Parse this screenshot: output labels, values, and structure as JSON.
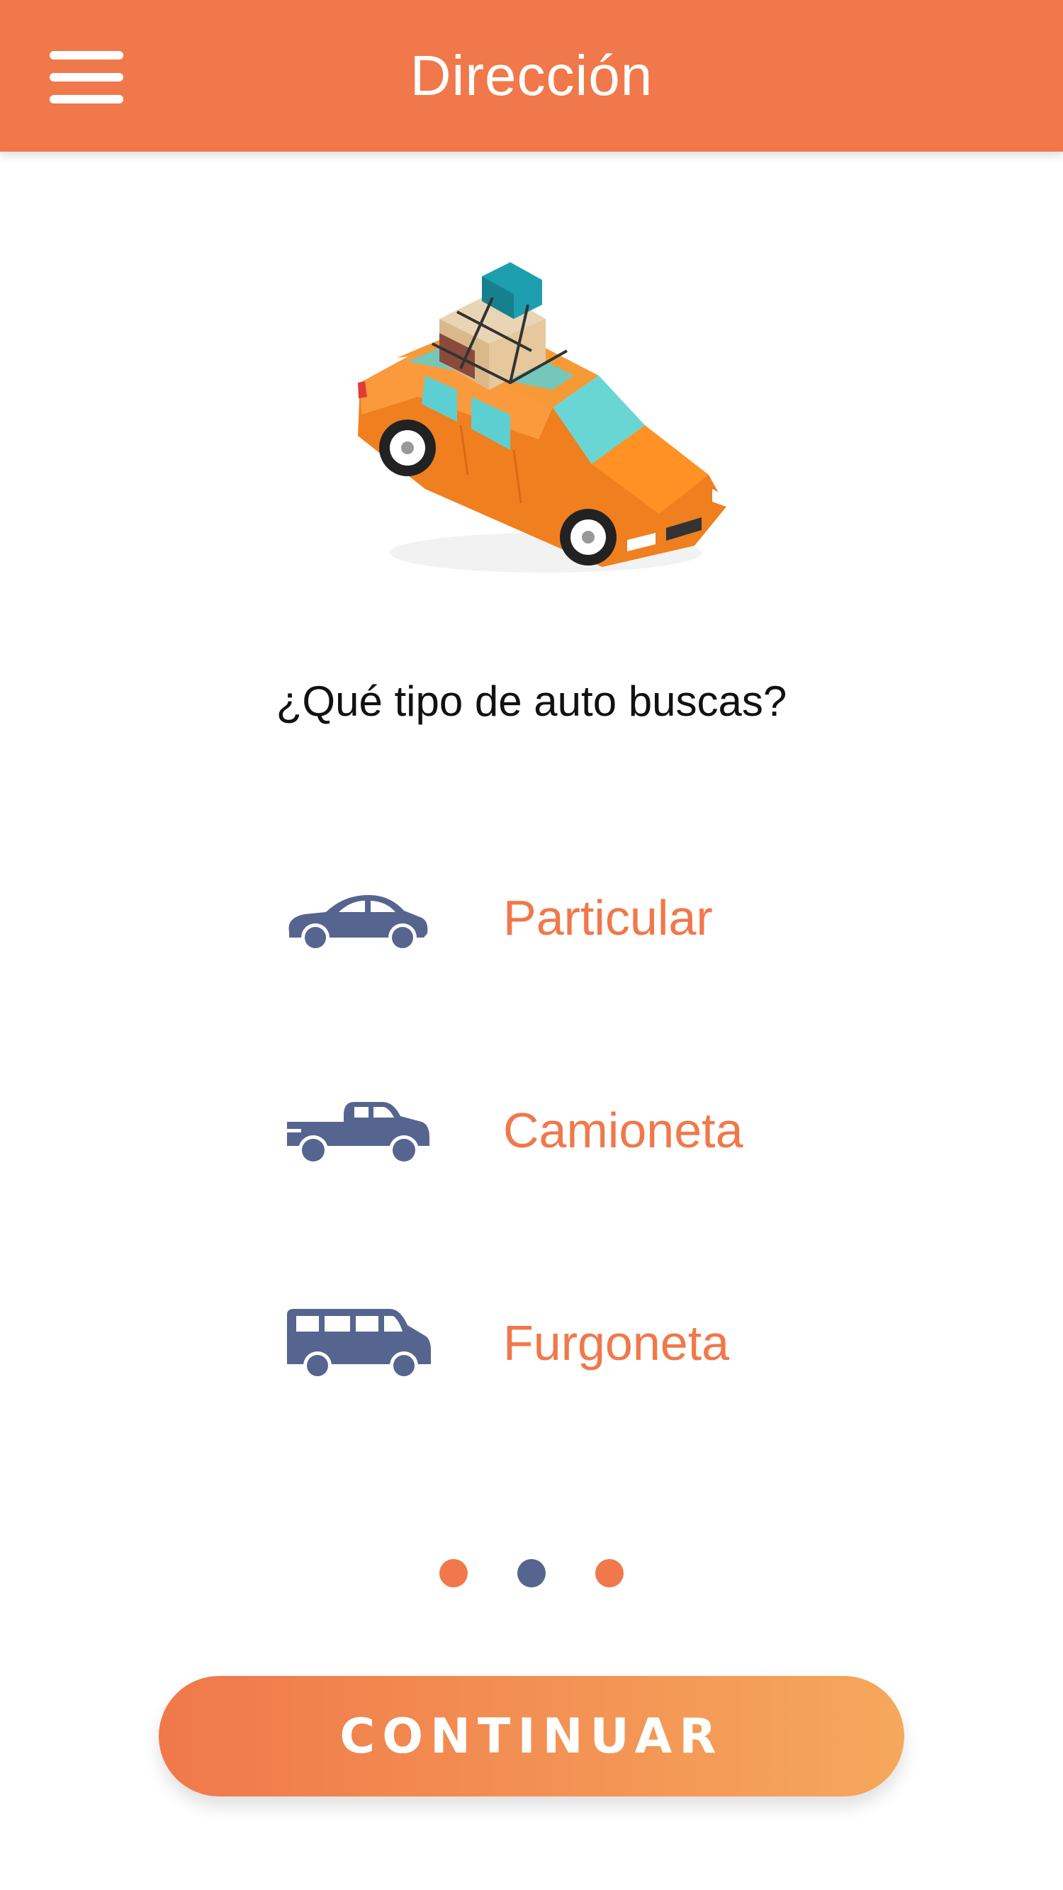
{
  "header": {
    "title": "Dirección",
    "menu_icon": "hamburger-menu-icon"
  },
  "hero": {
    "illustration": "car-with-luggage-illustration"
  },
  "question": "¿Qué tipo de auto buscas?",
  "options": [
    {
      "label": "Particular",
      "icon": "sedan-car-icon"
    },
    {
      "label": "Camioneta",
      "icon": "pickup-truck-icon"
    },
    {
      "label": "Furgoneta",
      "icon": "van-icon"
    }
  ],
  "pagination": {
    "total": 3,
    "active_index": 1
  },
  "continue_button": {
    "label": "CONTINUAR"
  },
  "colors": {
    "accent": "#f0784a",
    "accent_gradient_end": "#f5a85c",
    "icon_blue": "#56658f",
    "text": "#111111",
    "background": "#ffffff"
  }
}
